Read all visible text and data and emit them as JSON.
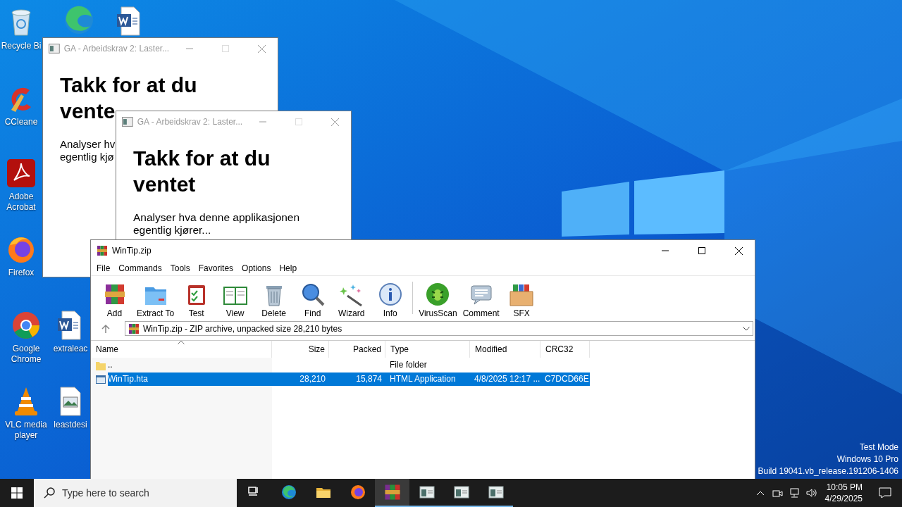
{
  "desktop": {
    "icons": [
      {
        "label": "Recycle Bi"
      },
      {
        "label": "CCleane"
      },
      {
        "label": "Adobe Acrobat"
      },
      {
        "label": "Firefox"
      },
      {
        "label": "Google Chrome"
      },
      {
        "label": "extraleac"
      },
      {
        "label": "VLC media player"
      },
      {
        "label": "leastdesi"
      }
    ],
    "system_info": [
      "Test Mode",
      "Windows 10 Pro",
      "Build 19041.vb_release.191206-1406"
    ]
  },
  "back_window": {
    "title": "GA - Arbeidskrav 2: Laster...",
    "heading_lines": [
      "Takk for at du",
      "vente"
    ],
    "text_lines": [
      "Analyser hv",
      "egentlig kjø"
    ]
  },
  "front_window": {
    "title": "GA - Arbeidskrav 2: Laster...",
    "heading": "Takk for at du ventet",
    "text": "Analyser hva denne applikasjonen egentlig kjører..."
  },
  "winrar": {
    "title": "WinTip.zip",
    "menu": [
      "File",
      "Commands",
      "Tools",
      "Favorites",
      "Options",
      "Help"
    ],
    "toolbar": [
      {
        "label": "Add",
        "separator_before": false
      },
      {
        "label": "Extract To",
        "separator_before": false
      },
      {
        "label": "Test",
        "separator_before": false
      },
      {
        "label": "View",
        "separator_before": false
      },
      {
        "label": "Delete",
        "separator_before": false
      },
      {
        "label": "Find",
        "separator_before": false
      },
      {
        "label": "Wizard",
        "separator_before": false
      },
      {
        "label": "Info",
        "separator_before": false
      },
      {
        "label": "VirusScan",
        "separator_before": true
      },
      {
        "label": "Comment",
        "separator_before": false
      },
      {
        "label": "SFX",
        "separator_before": false
      }
    ],
    "path": "WinTip.zip - ZIP archive, unpacked size 28,210 bytes",
    "columns": [
      {
        "label": "Name",
        "sorted": true
      },
      {
        "label": "Size",
        "sorted": false
      },
      {
        "label": "Packed",
        "sorted": false
      },
      {
        "label": "Type",
        "sorted": false
      },
      {
        "label": "Modified",
        "sorted": false
      },
      {
        "label": "CRC32",
        "sorted": false
      }
    ],
    "rows": [
      {
        "kind": "folder",
        "name": "..",
        "type": "File folder",
        "selected": false
      },
      {
        "kind": "file",
        "name": "WinTip.hta",
        "size": "28,210",
        "packed": "15,874",
        "type": "HTML Application",
        "modified": "4/8/2025 12:17 ...",
        "crc32": "C7DCD66E",
        "selected": true
      }
    ]
  },
  "taskbar": {
    "search_placeholder": "Type here to search",
    "apps": [
      {
        "selected": false,
        "running": false
      },
      {
        "selected": false,
        "running": false
      },
      {
        "selected": false,
        "running": false
      },
      {
        "selected": false,
        "running": false
      },
      {
        "selected": true,
        "running": true
      },
      {
        "selected": false,
        "running": true
      },
      {
        "selected": false,
        "running": true
      },
      {
        "selected": false,
        "running": true
      }
    ],
    "time": "10:05 PM",
    "date": "4/29/2025"
  }
}
